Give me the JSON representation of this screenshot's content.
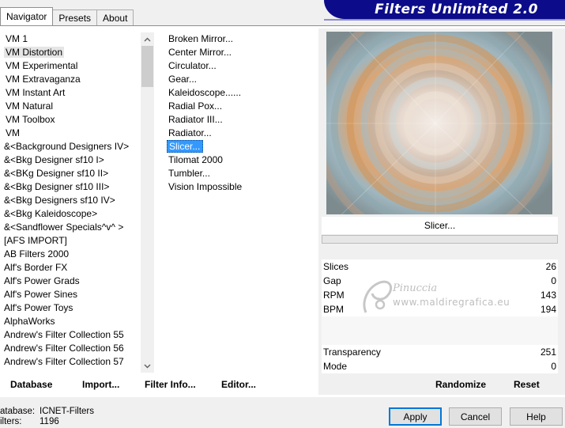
{
  "tabs": [
    {
      "label": "Navigator",
      "active": true
    },
    {
      "label": "Presets",
      "active": false
    },
    {
      "label": "About",
      "active": false
    }
  ],
  "banner_title": "Filters Unlimited 2.0",
  "categories": [
    "VM 1",
    "VM Distortion",
    "VM Experimental",
    "VM Extravaganza",
    "VM Instant Art",
    "VM Natural",
    "VM Toolbox",
    "VM",
    "&<Background Designers IV>",
    "&<Bkg Designer sf10 I>",
    "&<BKg Designer sf10 II>",
    "&<Bkg Designer sf10 III>",
    "&<Bkg Designers sf10 IV>",
    "&<Bkg Kaleidoscope>",
    "&<Sandflower Specials^v^ >",
    "[AFS IMPORT]",
    "AB Filters 2000",
    "Alf's Border FX",
    "Alf's Power Grads",
    "Alf's Power Sines",
    "Alf's Power Toys",
    "AlphaWorks",
    "Andrew's Filter Collection 55",
    "Andrew's Filter Collection 56",
    "Andrew's Filter Collection 57"
  ],
  "selected_category": "VM Distortion",
  "filters": [
    "Broken Mirror...",
    "Center Mirror...",
    "Circulator...",
    "Gear...",
    "Kaleidoscope......",
    "Radial Pox...",
    "Radiator III...",
    "Radiator...",
    "Slicer...",
    "Tilomat 2000",
    "Tumbler...",
    "Vision Impossible"
  ],
  "selected_filter": "Slicer...",
  "filter_name": "Slicer...",
  "params": [
    {
      "label": "Slices",
      "value": "26"
    },
    {
      "label": "Gap",
      "value": "0"
    },
    {
      "label": "RPM",
      "value": "143"
    },
    {
      "label": "BPM",
      "value": "194"
    },
    {
      "label": "",
      "value": ""
    },
    {
      "label": "",
      "value": ""
    },
    {
      "label": "Transparency",
      "value": "251"
    },
    {
      "label": "Mode",
      "value": "0"
    }
  ],
  "watermark": {
    "name": "Pinuccia",
    "url": "www.maldiregrafica.eu"
  },
  "commands": {
    "database": "Database",
    "import": "Import...",
    "filter_info": "Filter Info...",
    "editor": "Editor...",
    "randomize": "Randomize",
    "reset": "Reset"
  },
  "status": {
    "database_key": "atabase:",
    "database_value": "ICNET-Filters",
    "filters_key": "ilters:",
    "filters_value": "1196"
  },
  "dialog_buttons": {
    "apply": "Apply",
    "cancel": "Cancel",
    "help": "Help"
  },
  "colors": {
    "accent": "#3399ff",
    "banner": "#0c0c8a",
    "default_button_border": "#0078d7"
  },
  "icons": {
    "scroll_up": "chevron-up-icon",
    "scroll_down": "chevron-down-icon"
  }
}
